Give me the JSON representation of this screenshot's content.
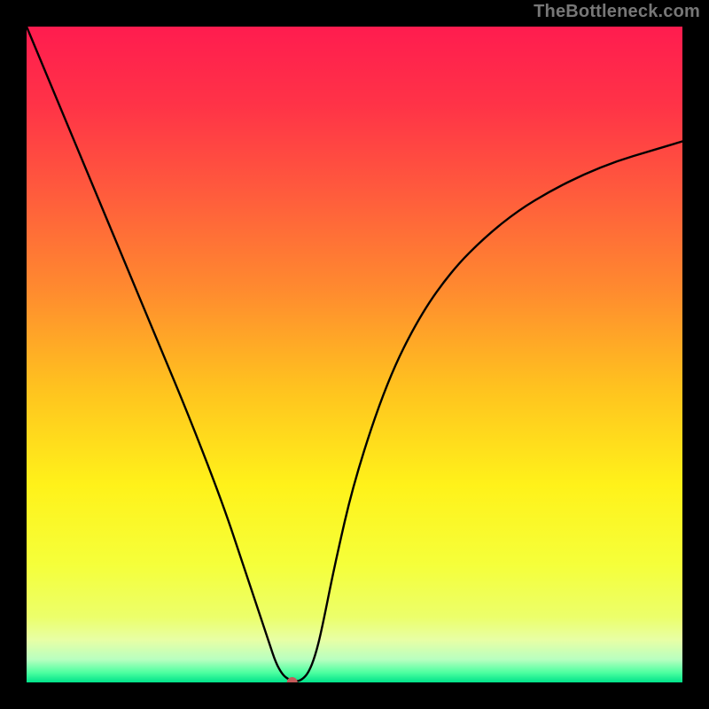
{
  "watermark": "TheBottleneck.com",
  "chart_data": {
    "type": "line",
    "title": "",
    "xlabel": "",
    "ylabel": "",
    "xlim": [
      0,
      100
    ],
    "ylim": [
      0,
      100
    ],
    "grid": false,
    "annotations": [],
    "marker": {
      "x": 40.5,
      "y": 0,
      "color": "#c45a5a",
      "r": 6
    },
    "green_band_top_y": 7,
    "background_gradient": {
      "stops": [
        {
          "offset": 0.0,
          "color": "#ff1c4f"
        },
        {
          "offset": 0.12,
          "color": "#ff3347"
        },
        {
          "offset": 0.25,
          "color": "#ff5a3d"
        },
        {
          "offset": 0.4,
          "color": "#ff8a2f"
        },
        {
          "offset": 0.55,
          "color": "#ffc21f"
        },
        {
          "offset": 0.7,
          "color": "#fff21a"
        },
        {
          "offset": 0.82,
          "color": "#f5ff3a"
        },
        {
          "offset": 0.9,
          "color": "#ecff6a"
        },
        {
          "offset": 0.935,
          "color": "#e8ffa5"
        },
        {
          "offset": 0.965,
          "color": "#b8ffc0"
        },
        {
          "offset": 0.985,
          "color": "#4dffa0"
        },
        {
          "offset": 1.0,
          "color": "#00e28a"
        }
      ]
    },
    "series": [
      {
        "name": "curve",
        "x": [
          0,
          5,
          10,
          15,
          20,
          25,
          30,
          33,
          35,
          37,
          38,
          39,
          40,
          41,
          42,
          43,
          44,
          45,
          47,
          50,
          55,
          60,
          65,
          70,
          75,
          80,
          85,
          90,
          95,
          100
        ],
        "y": [
          100,
          88,
          76,
          64,
          52,
          40,
          27,
          18,
          12,
          6,
          3,
          1.2,
          0.4,
          0.1,
          0.4,
          1.5,
          4,
          8,
          18,
          31,
          46,
          56,
          63,
          68,
          72,
          75,
          77.5,
          79.5,
          81,
          82.5
        ]
      }
    ]
  }
}
